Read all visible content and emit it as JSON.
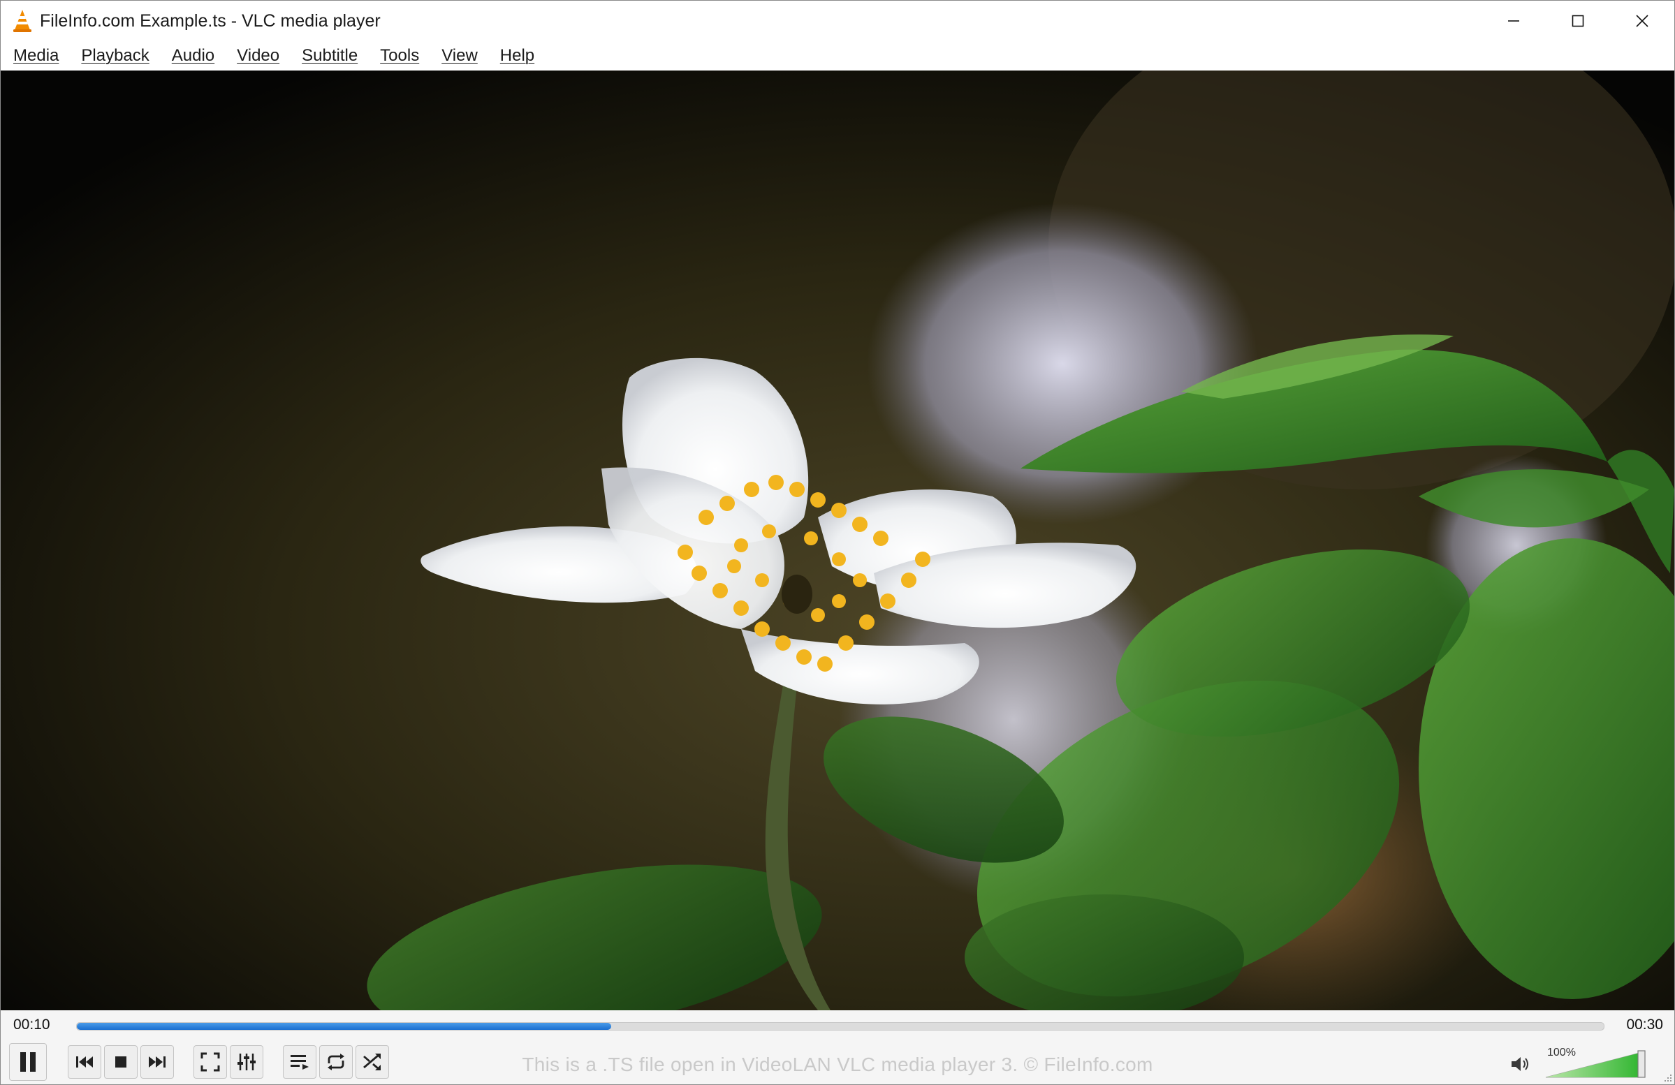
{
  "window": {
    "title": "FileInfo.com Example.ts - VLC media player",
    "app_icon": "vlc-cone-icon"
  },
  "menu": [
    {
      "label": "Media"
    },
    {
      "label": "Playback"
    },
    {
      "label": "Audio"
    },
    {
      "label": "Video"
    },
    {
      "label": "Subtitle"
    },
    {
      "label": "Tools"
    },
    {
      "label": "View"
    },
    {
      "label": "Help"
    }
  ],
  "playback": {
    "elapsed": "00:10",
    "total": "00:30",
    "progress_fraction": 0.35,
    "state": "playing"
  },
  "controls": {
    "buttons": [
      "pause-icon",
      "previous-icon",
      "stop-icon",
      "next-icon",
      "fullscreen-icon",
      "extended-settings-icon",
      "playlist-icon",
      "loop-icon",
      "shuffle-icon"
    ],
    "caption": "This is a .TS file open in VideoLAN VLC media player 3. © FileInfo.com"
  },
  "volume": {
    "label": "100%",
    "fraction": 1.0,
    "icon": "speaker-icon"
  },
  "colors": {
    "accent": "#1b6fd0",
    "volume_green": "#3fbf3f"
  }
}
